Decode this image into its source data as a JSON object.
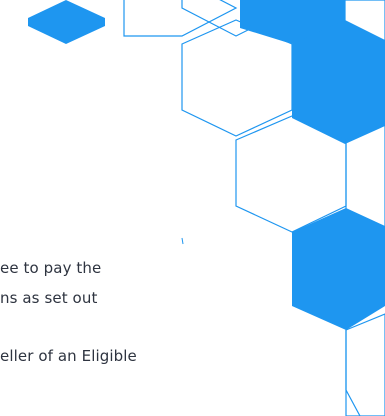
{
  "body_text": {
    "line_1": "ee to pay the",
    "line_2": "ns as set out",
    "line_3": "eller of an Eligible"
  },
  "decoration": {
    "accent_color": "#1e96f0",
    "outline_color": "#1e96f0",
    "pattern": "hexagon-grid"
  }
}
